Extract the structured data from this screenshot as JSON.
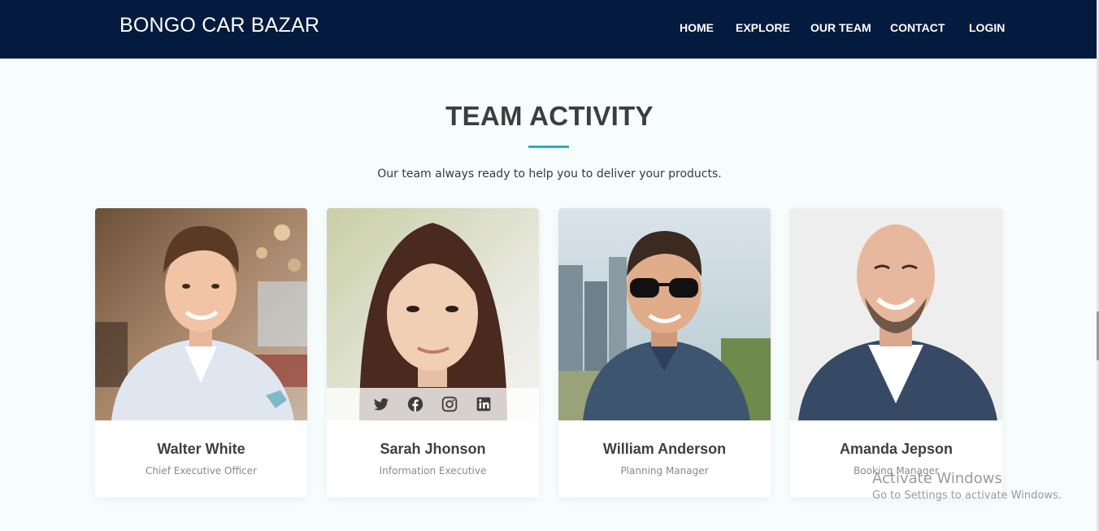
{
  "brand": "BONGO CAR BAZAR",
  "nav": {
    "home": "HOME",
    "explore": "EXPLORE",
    "our_team": "OUR TEAM",
    "contact": "CONTACT",
    "login": "LOGIN"
  },
  "section": {
    "title": "TEAM ACTIVITY",
    "subtitle": "Our team always ready to help you to deliver your products."
  },
  "team": [
    {
      "name": "Walter White",
      "role": "Chief Executive Officer"
    },
    {
      "name": "Sarah Jhonson",
      "role": "Information Executive"
    },
    {
      "name": "William Anderson",
      "role": "Planning Manager"
    },
    {
      "name": "Amanda Jepson",
      "role": "Booking Manager"
    }
  ],
  "social_icons": [
    "twitter-icon",
    "facebook-icon",
    "instagram-icon",
    "linkedin-icon"
  ],
  "watermark": {
    "title": "Activate Windows",
    "subtitle": "Go to Settings to activate Windows."
  },
  "colors": {
    "navbar": "#041b3f",
    "accent": "#26b0b8",
    "page_bg": "#f6fdfc"
  }
}
